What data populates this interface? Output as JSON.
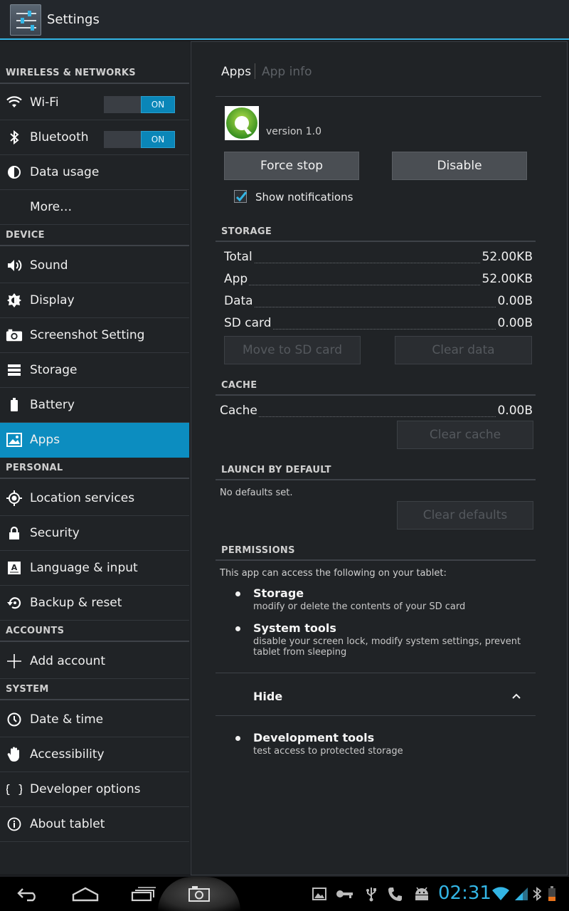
{
  "actionbar": {
    "title": "Settings",
    "icon": "settings-sliders-icon"
  },
  "sidebar": {
    "headers": {
      "wireless": "WIRELESS & NETWORKS",
      "device": "DEVICE",
      "personal": "PERSONAL",
      "accounts": "ACCOUNTS",
      "system": "SYSTEM"
    },
    "items": [
      {
        "label": "Wi-Fi",
        "icon": "wifi-icon",
        "toggle": "ON"
      },
      {
        "label": "Bluetooth",
        "icon": "bluetooth-icon",
        "toggle": "ON"
      },
      {
        "label": "Data usage",
        "icon": "data-usage-icon"
      },
      {
        "label": "More…",
        "icon": ""
      },
      {
        "label": "Sound",
        "icon": "speaker-icon"
      },
      {
        "label": "Display",
        "icon": "brightness-icon"
      },
      {
        "label": "Screenshot Setting",
        "icon": "camera-icon"
      },
      {
        "label": "Storage",
        "icon": "storage-icon"
      },
      {
        "label": "Battery",
        "icon": "battery-icon"
      },
      {
        "label": "Apps",
        "icon": "apps-icon",
        "selected": true
      },
      {
        "label": "Location services",
        "icon": "location-icon"
      },
      {
        "label": "Security",
        "icon": "lock-icon"
      },
      {
        "label": "Language & input",
        "icon": "language-icon"
      },
      {
        "label": "Backup & reset",
        "icon": "backup-icon"
      },
      {
        "label": "Add account",
        "icon": "plus-icon"
      },
      {
        "label": "Date & time",
        "icon": "clock-icon"
      },
      {
        "label": "Accessibility",
        "icon": "hand-icon"
      },
      {
        "label": "Developer options",
        "icon": "braces-icon"
      },
      {
        "label": "About tablet",
        "icon": "info-icon"
      }
    ]
  },
  "detail": {
    "breadcrumb": {
      "current": "Apps",
      "next": "App info"
    },
    "app": {
      "version": "version 1.0"
    },
    "buttons": {
      "force_stop": "Force stop",
      "disable": "Disable"
    },
    "show_notifications": {
      "label": "Show notifications",
      "checked": true
    },
    "storage": {
      "title": "STORAGE",
      "rows": [
        {
          "k": "Total",
          "v": "52.00KB"
        },
        {
          "k": "App",
          "v": "52.00KB"
        },
        {
          "k": "Data",
          "v": "0.00B"
        },
        {
          "k": "SD card",
          "v": "0.00B"
        }
      ],
      "move_btn": "Move to SD card",
      "clear_btn": "Clear data"
    },
    "cache": {
      "title": "CACHE",
      "k": "Cache",
      "v": "0.00B",
      "btn": "Clear cache"
    },
    "launch": {
      "title": "LAUNCH BY DEFAULT",
      "text": "No defaults set.",
      "btn": "Clear defaults"
    },
    "permissions": {
      "title": "PERMISSIONS",
      "intro": "This app can access the following on your tablet:",
      "items": [
        {
          "title": "Storage",
          "desc": "modify or delete the contents of your SD card"
        },
        {
          "title": "System tools",
          "desc": "disable your screen lock, modify system settings, prevent tablet from sleeping"
        }
      ],
      "hide": "Hide",
      "more": [
        {
          "title": "Development tools",
          "desc": "test access to protected storage"
        }
      ]
    }
  },
  "navbar": {
    "clock": "02:31",
    "accent": "#33b5e5"
  }
}
